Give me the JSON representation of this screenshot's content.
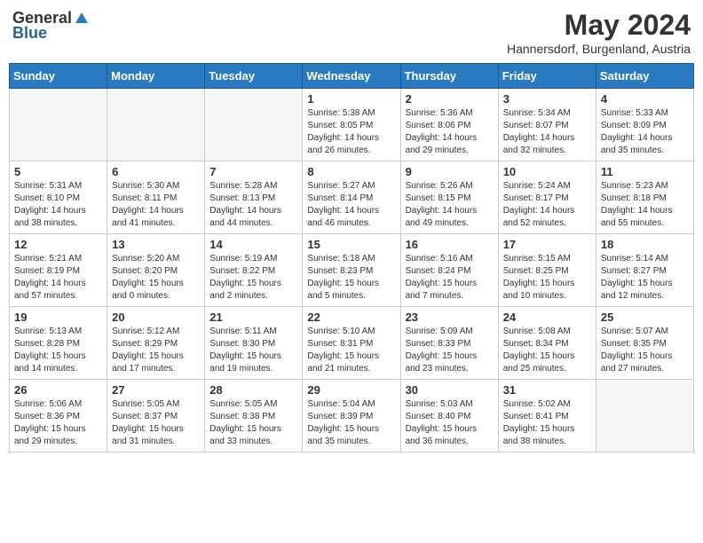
{
  "logo": {
    "general": "General",
    "blue": "Blue"
  },
  "title": "May 2024",
  "subtitle": "Hannersdorf, Burgenland, Austria",
  "days_of_week": [
    "Sunday",
    "Monday",
    "Tuesday",
    "Wednesday",
    "Thursday",
    "Friday",
    "Saturday"
  ],
  "weeks": [
    [
      {
        "day": "",
        "info": ""
      },
      {
        "day": "",
        "info": ""
      },
      {
        "day": "",
        "info": ""
      },
      {
        "day": "1",
        "info": "Sunrise: 5:38 AM\nSunset: 8:05 PM\nDaylight: 14 hours and 26 minutes."
      },
      {
        "day": "2",
        "info": "Sunrise: 5:36 AM\nSunset: 8:06 PM\nDaylight: 14 hours and 29 minutes."
      },
      {
        "day": "3",
        "info": "Sunrise: 5:34 AM\nSunset: 8:07 PM\nDaylight: 14 hours and 32 minutes."
      },
      {
        "day": "4",
        "info": "Sunrise: 5:33 AM\nSunset: 8:09 PM\nDaylight: 14 hours and 35 minutes."
      }
    ],
    [
      {
        "day": "5",
        "info": "Sunrise: 5:31 AM\nSunset: 8:10 PM\nDaylight: 14 hours and 38 minutes."
      },
      {
        "day": "6",
        "info": "Sunrise: 5:30 AM\nSunset: 8:11 PM\nDaylight: 14 hours and 41 minutes."
      },
      {
        "day": "7",
        "info": "Sunrise: 5:28 AM\nSunset: 8:13 PM\nDaylight: 14 hours and 44 minutes."
      },
      {
        "day": "8",
        "info": "Sunrise: 5:27 AM\nSunset: 8:14 PM\nDaylight: 14 hours and 46 minutes."
      },
      {
        "day": "9",
        "info": "Sunrise: 5:26 AM\nSunset: 8:15 PM\nDaylight: 14 hours and 49 minutes."
      },
      {
        "day": "10",
        "info": "Sunrise: 5:24 AM\nSunset: 8:17 PM\nDaylight: 14 hours and 52 minutes."
      },
      {
        "day": "11",
        "info": "Sunrise: 5:23 AM\nSunset: 8:18 PM\nDaylight: 14 hours and 55 minutes."
      }
    ],
    [
      {
        "day": "12",
        "info": "Sunrise: 5:21 AM\nSunset: 8:19 PM\nDaylight: 14 hours and 57 minutes."
      },
      {
        "day": "13",
        "info": "Sunrise: 5:20 AM\nSunset: 8:20 PM\nDaylight: 15 hours and 0 minutes."
      },
      {
        "day": "14",
        "info": "Sunrise: 5:19 AM\nSunset: 8:22 PM\nDaylight: 15 hours and 2 minutes."
      },
      {
        "day": "15",
        "info": "Sunrise: 5:18 AM\nSunset: 8:23 PM\nDaylight: 15 hours and 5 minutes."
      },
      {
        "day": "16",
        "info": "Sunrise: 5:16 AM\nSunset: 8:24 PM\nDaylight: 15 hours and 7 minutes."
      },
      {
        "day": "17",
        "info": "Sunrise: 5:15 AM\nSunset: 8:25 PM\nDaylight: 15 hours and 10 minutes."
      },
      {
        "day": "18",
        "info": "Sunrise: 5:14 AM\nSunset: 8:27 PM\nDaylight: 15 hours and 12 minutes."
      }
    ],
    [
      {
        "day": "19",
        "info": "Sunrise: 5:13 AM\nSunset: 8:28 PM\nDaylight: 15 hours and 14 minutes."
      },
      {
        "day": "20",
        "info": "Sunrise: 5:12 AM\nSunset: 8:29 PM\nDaylight: 15 hours and 17 minutes."
      },
      {
        "day": "21",
        "info": "Sunrise: 5:11 AM\nSunset: 8:30 PM\nDaylight: 15 hours and 19 minutes."
      },
      {
        "day": "22",
        "info": "Sunrise: 5:10 AM\nSunset: 8:31 PM\nDaylight: 15 hours and 21 minutes."
      },
      {
        "day": "23",
        "info": "Sunrise: 5:09 AM\nSunset: 8:33 PM\nDaylight: 15 hours and 23 minutes."
      },
      {
        "day": "24",
        "info": "Sunrise: 5:08 AM\nSunset: 8:34 PM\nDaylight: 15 hours and 25 minutes."
      },
      {
        "day": "25",
        "info": "Sunrise: 5:07 AM\nSunset: 8:35 PM\nDaylight: 15 hours and 27 minutes."
      }
    ],
    [
      {
        "day": "26",
        "info": "Sunrise: 5:06 AM\nSunset: 8:36 PM\nDaylight: 15 hours and 29 minutes."
      },
      {
        "day": "27",
        "info": "Sunrise: 5:05 AM\nSunset: 8:37 PM\nDaylight: 15 hours and 31 minutes."
      },
      {
        "day": "28",
        "info": "Sunrise: 5:05 AM\nSunset: 8:38 PM\nDaylight: 15 hours and 33 minutes."
      },
      {
        "day": "29",
        "info": "Sunrise: 5:04 AM\nSunset: 8:39 PM\nDaylight: 15 hours and 35 minutes."
      },
      {
        "day": "30",
        "info": "Sunrise: 5:03 AM\nSunset: 8:40 PM\nDaylight: 15 hours and 36 minutes."
      },
      {
        "day": "31",
        "info": "Sunrise: 5:02 AM\nSunset: 8:41 PM\nDaylight: 15 hours and 38 minutes."
      },
      {
        "day": "",
        "info": ""
      }
    ]
  ]
}
